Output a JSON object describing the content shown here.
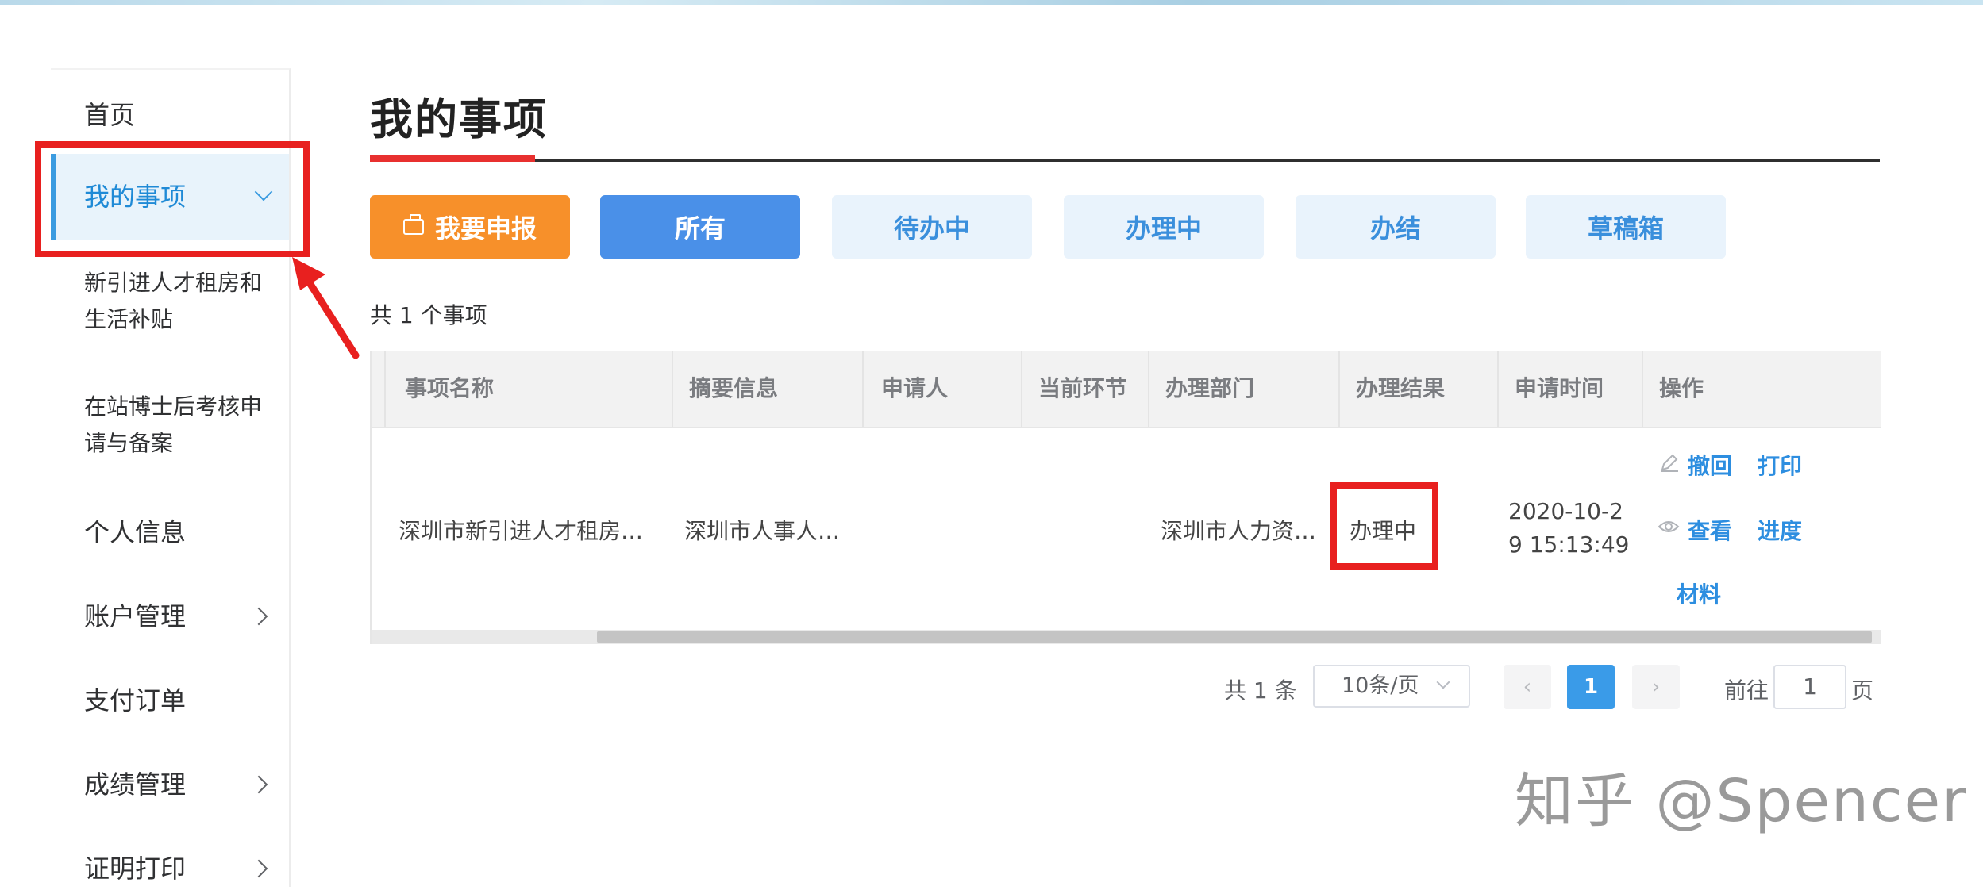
{
  "sidebar": {
    "items": [
      {
        "label": "首页"
      },
      {
        "label": "我的事项"
      },
      {
        "label": "个人信息"
      },
      {
        "label": "账户管理"
      },
      {
        "label": "支付订单"
      },
      {
        "label": "成绩管理"
      },
      {
        "label": "证明打印"
      }
    ],
    "sub_items": [
      {
        "label": "新引进人才租房和生活补贴"
      },
      {
        "label": "在站博士后考核申请与备案"
      }
    ]
  },
  "main": {
    "title": "我的事项",
    "buttons": {
      "apply": "我要申报",
      "all": "所有",
      "pending": "待办中",
      "processing": "办理中",
      "done": "办结",
      "drafts": "草稿箱"
    },
    "total_count": "共 1 个事项"
  },
  "table": {
    "headers": [
      "事项名称",
      "摘要信息",
      "申请人",
      "当前环节",
      "办理部门",
      "办理结果",
      "申请时间",
      "操作"
    ],
    "rows": [
      {
        "name": "深圳市新引进人才租房…",
        "summary": "深圳市人事人…",
        "applicant": "",
        "step": "",
        "department": "深圳市人力资…",
        "result": "办理中",
        "time_line1": "2020-10-2",
        "time_line2": "9 15:13:49",
        "actions": {
          "withdraw": "撤回",
          "print": "打印",
          "view": "查看",
          "progress": "进度",
          "materials": "材料"
        }
      }
    ]
  },
  "pagination": {
    "total": "共 1 条",
    "page_size": "10条/页",
    "current_page": "1",
    "goto_label": "前往",
    "goto_value": "1",
    "page_suffix": "页",
    "prev_symbol": "‹",
    "next_symbol": "›"
  },
  "watermark": "知乎 @Spencer",
  "colors": {
    "accent_blue": "#4a90e8",
    "orange": "#f7902a",
    "highlight_red": "#e8201f",
    "link_blue": "#2d8ee0"
  }
}
